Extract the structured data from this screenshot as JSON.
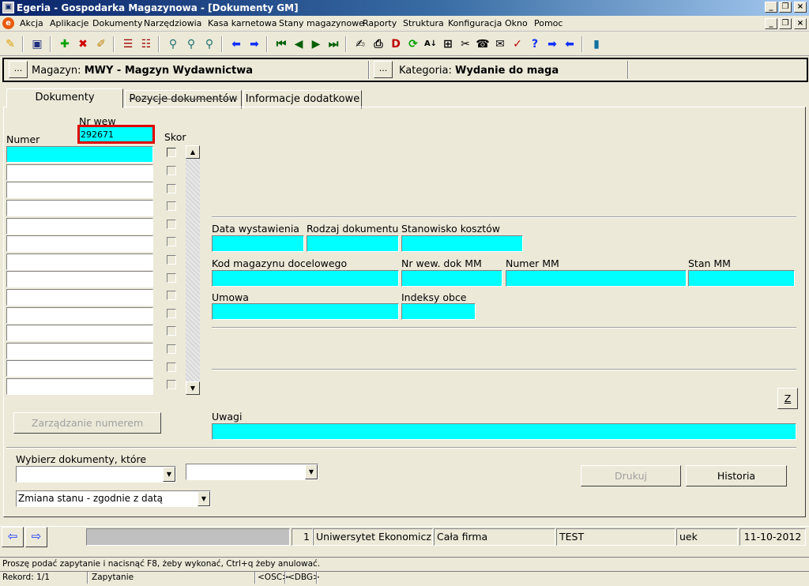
{
  "window": {
    "title": "Egeria - Gospodarka Magazynowa - [Dokumenty GM]"
  },
  "menu": [
    "Akcja",
    "Aplikacje",
    "Dokumenty",
    "Narzędziowia",
    "Kasa karnetowa",
    "Stany magazynowe",
    "Raporty",
    "Struktura",
    "Konfiguracja",
    "Okno",
    "Pomoc"
  ],
  "context": {
    "dots_label": "...",
    "magazyn_label": "Magazyn:",
    "magazyn_value": "MWY - Magzyn Wydawnictwa",
    "kategoria_label": "Kategoria:",
    "kategoria_value": "Wydanie do maga"
  },
  "tabs": [
    "Dokumenty",
    "Pozycje dokumentów",
    "Informacje dodatkowe"
  ],
  "list": {
    "numer_label": "Numer",
    "nrwew_label": "Nr wew",
    "nrwew_value": "292671",
    "skor_label": "Skor"
  },
  "fields": {
    "data_wystawienia": "Data wystawienia",
    "rodzaj_dokumentu": "Rodzaj dokumentu",
    "stanowisko_kosztow": "Stanowisko kosztów",
    "kod_magazynu": "Kod magazynu docelowego",
    "nr_wew_dok_mm": "Nr wew. dok MM",
    "numer_mm": "Numer MM",
    "stan_mm": "Stan MM",
    "umowa": "Umowa",
    "indeksy_obce": "Indeksy obce",
    "uwagi": "Uwagi",
    "z_button": "Z"
  },
  "buttons": {
    "zarzadzanie": "Zarządzanie numerem",
    "drukuj": "Drukuj",
    "historia": "Historia"
  },
  "filters": {
    "wybierz_label": "Wybierz dokumenty, które",
    "combo1": "",
    "combo2": "",
    "stan_combo": "Zmiana stanu - zgodnie z datą"
  },
  "statusbar": {
    "count": "1",
    "org": "Uniwersytet Ekonomiczny",
    "company": "Cała firma",
    "env": "TEST",
    "user": "uek",
    "date": "11-10-2012"
  },
  "messages": {
    "hint": "Proszę podać zapytanie i nacisnąć F8, żeby wykonać, Ctrl+q  żeby anulować.",
    "record": "Rekord: 1/1",
    "mode": "Zapytanie",
    "osc": "<OSC>",
    "dbg": "<DBG>"
  }
}
